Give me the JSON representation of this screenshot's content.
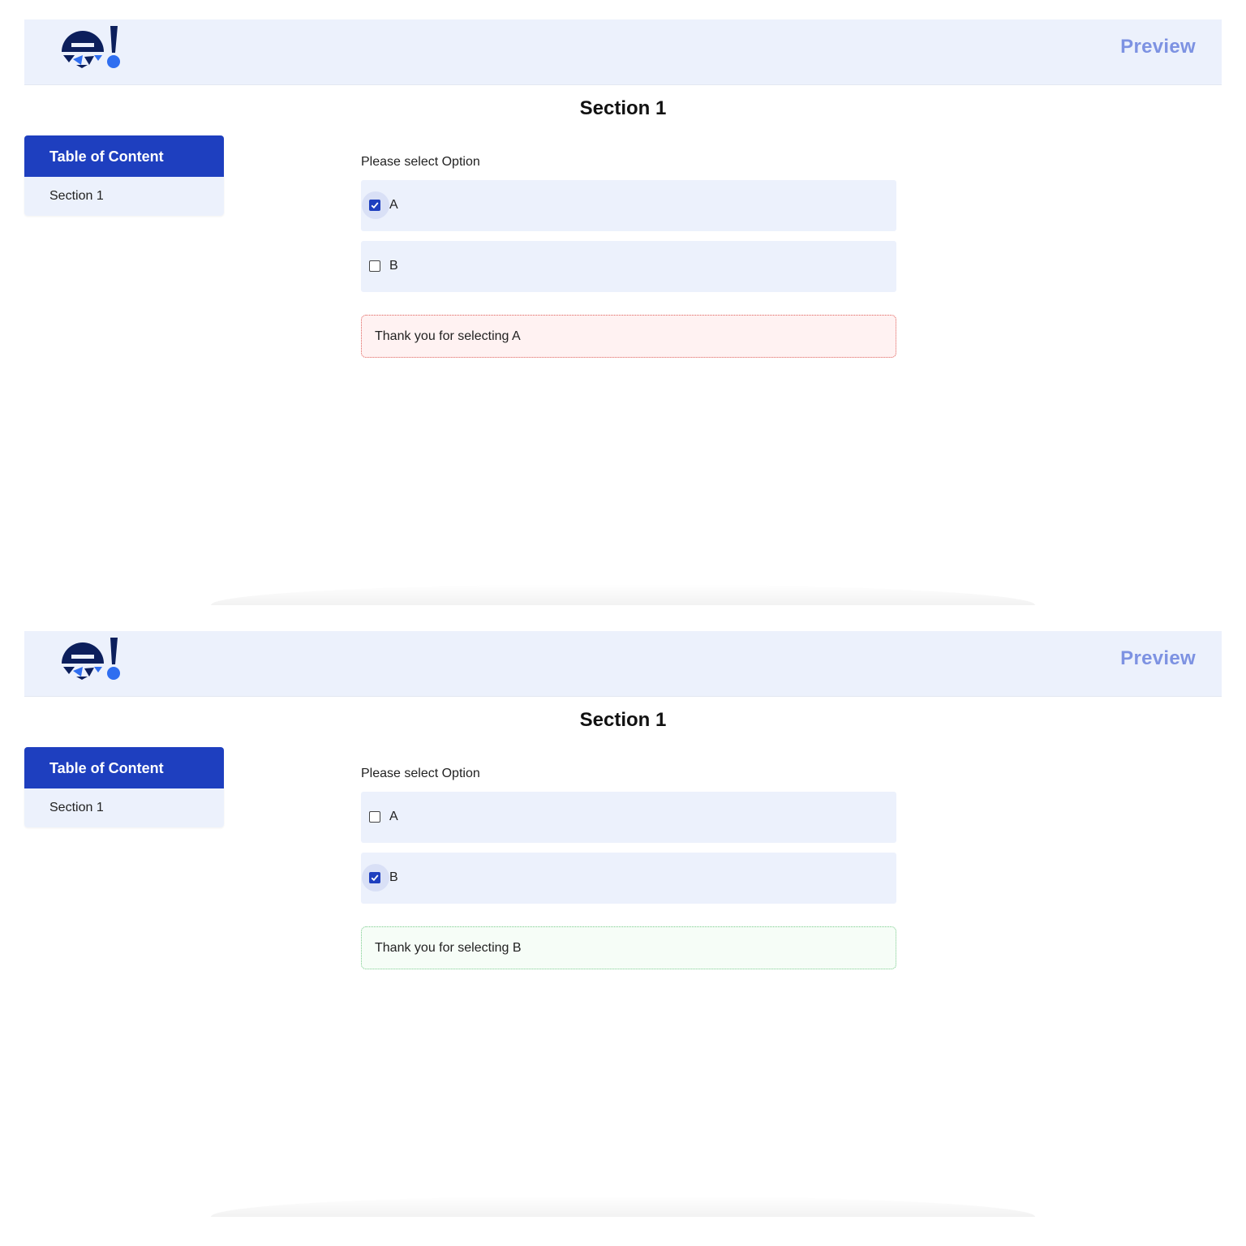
{
  "screens": [
    {
      "header": {
        "preview_label": "Preview"
      },
      "page_title": "Section 1",
      "toc": {
        "heading": "Table of Content",
        "items": [
          {
            "label": "Section 1"
          }
        ]
      },
      "question": "Please select Option",
      "options": [
        {
          "label": "A",
          "checked": true
        },
        {
          "label": "B",
          "checked": false
        }
      ],
      "feedback": {
        "text": "Thank you for selecting A",
        "status": "error"
      }
    },
    {
      "header": {
        "preview_label": "Preview"
      },
      "page_title": "Section 1",
      "toc": {
        "heading": "Table of Content",
        "items": [
          {
            "label": "Section 1"
          }
        ]
      },
      "question": "Please select Option",
      "options": [
        {
          "label": "A",
          "checked": false
        },
        {
          "label": "B",
          "checked": true
        }
      ],
      "feedback": {
        "text": "Thank you for selecting B",
        "status": "success"
      }
    }
  ],
  "colors": {
    "brand_primary": "#1e3fbf",
    "logo_dark": "#0c1f5c",
    "logo_accent": "#2f6ef0",
    "header_bg": "#ecf1fc",
    "preview_text": "#7d92e2",
    "error_border": "#e0605b",
    "error_bg": "#fff2f2",
    "success_border": "#79cc8c",
    "success_bg": "#f6fdf7"
  },
  "icons": {
    "logo": "brand-logo-icon",
    "checked": "checkbox-checked-icon",
    "unchecked": "checkbox-unchecked-icon"
  }
}
